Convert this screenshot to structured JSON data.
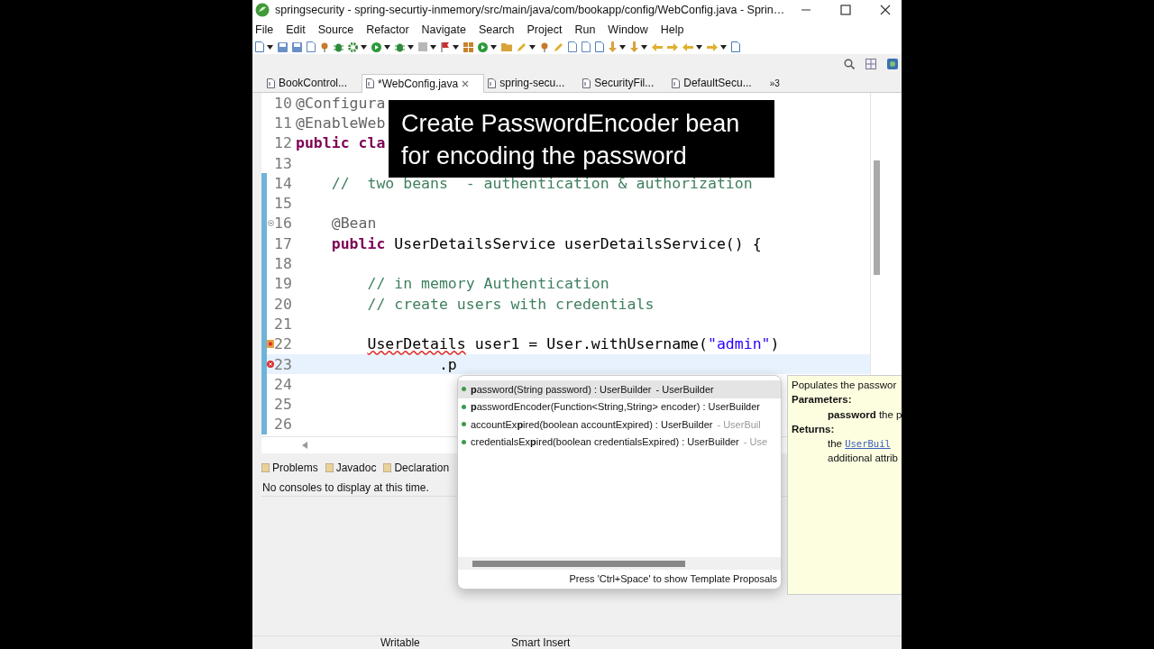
{
  "window": {
    "title": "springsecurity - spring-securtiy-inmemory/src/main/java/com/bookapp/config/WebConfig.java - Sprin…"
  },
  "menu": [
    "File",
    "Edit",
    "Source",
    "Refactor",
    "Navigate",
    "Search",
    "Project",
    "Run",
    "Window",
    "Help"
  ],
  "editor_tabs": [
    {
      "label": "BookControl...",
      "selected": false
    },
    {
      "label": "*WebConfig.java",
      "selected": true
    },
    {
      "label": "spring-secu...",
      "selected": false
    },
    {
      "label": "SecurityFil...",
      "selected": false
    },
    {
      "label": "DefaultSecu...",
      "selected": false
    }
  ],
  "tabs_overflow": "»3",
  "code_lines": [
    {
      "number": "10",
      "changed": false,
      "current": false,
      "segments": [
        {
          "kind": "annotation",
          "text": "@Configura"
        }
      ]
    },
    {
      "number": "11",
      "changed": false,
      "current": false,
      "segments": [
        {
          "kind": "annotation",
          "text": "@EnableWeb"
        }
      ]
    },
    {
      "number": "12",
      "changed": false,
      "current": false,
      "segments": [
        {
          "kind": "keyword",
          "text": "public"
        },
        {
          "kind": "keyword",
          "text": " cla"
        }
      ]
    },
    {
      "number": "13",
      "changed": false,
      "current": false
    },
    {
      "number": "14",
      "changed": true,
      "current": false,
      "segments": [
        {
          "kind": "comment",
          "text": "    //  two beans  - authentication & authorization"
        }
      ]
    },
    {
      "number": "15",
      "changed": true,
      "current": false
    },
    {
      "number": "16",
      "changed": true,
      "current": false,
      "marker": {
        "kind": "fold"
      },
      "segments": [
        {
          "kind": "annotation",
          "text": "    @Bean"
        }
      ]
    },
    {
      "number": "17",
      "changed": true,
      "current": false,
      "segments": [
        {
          "kind": "keyword",
          "text": "    public"
        },
        {
          "kind": "plain",
          "text": " UserDetailsService userDetailsService() {"
        }
      ]
    },
    {
      "number": "18",
      "changed": true,
      "current": false
    },
    {
      "number": "19",
      "changed": true,
      "current": false,
      "segments": [
        {
          "kind": "comment",
          "text": "        // in memory Authentication"
        }
      ]
    },
    {
      "number": "20",
      "changed": true,
      "current": false,
      "segments": [
        {
          "kind": "comment",
          "text": "        // create users with credentials"
        }
      ]
    },
    {
      "number": "21",
      "changed": true,
      "current": false
    },
    {
      "number": "22",
      "changed": true,
      "current": false,
      "marker": {
        "kind": "quickfix"
      },
      "segments": [
        {
          "kind": "error",
          "text": "        UserDetails"
        },
        {
          "kind": "plain",
          "text": " user1 = User.withUsername("
        },
        {
          "kind": "string",
          "text": "\"admin\""
        },
        {
          "kind": "plain",
          "text": ")"
        }
      ]
    },
    {
      "number": "23",
      "changed": true,
      "current": true,
      "marker": {
        "kind": "error"
      },
      "segments": [
        {
          "kind": "plain",
          "text": "                .p"
        }
      ]
    },
    {
      "number": "24",
      "changed": true,
      "current": false
    },
    {
      "number": "25",
      "changed": true,
      "current": false
    },
    {
      "number": "26",
      "changed": true,
      "current": false
    }
  ],
  "caption": {
    "lines": [
      "Create PasswordEncoder bean",
      "for encoding the password"
    ]
  },
  "completion": {
    "items": [
      {
        "text": "**p**assword(String password) : UserBuilder",
        "qualifier": "- UserBuilder",
        "selected": true
      },
      {
        "text": "**p**asswordEncoder(Function<String,String> encoder) : UserBuilder",
        "selected": false
      },
      {
        "text": "accountEx**p**ired(boolean accountExpired) : UserBuilder",
        "qualifier": "- UserBuil",
        "selected": false
      },
      {
        "text": "credentialsEx**p**ired(boolean credentialsExpired) : UserBuilder",
        "qualifier": "- Use",
        "selected": false
      }
    ],
    "hint": "Press 'Ctrl+Space' to show Template Proposals"
  },
  "javadoc": {
    "summary": "Populates the passwor",
    "params_heading": "Parameters:",
    "param": "**password** the p",
    "returns_heading": "Returns:",
    "returns_prefix": "the",
    "returns_link": "UserBuil",
    "returns_rest": "additional attrib"
  },
  "bottom_tabs": [
    "Problems",
    "Javadoc",
    "Declaration"
  ],
  "console_message": "No consoles to display at this time.",
  "status_bar": [
    "Writable",
    "Smart Insert"
  ]
}
